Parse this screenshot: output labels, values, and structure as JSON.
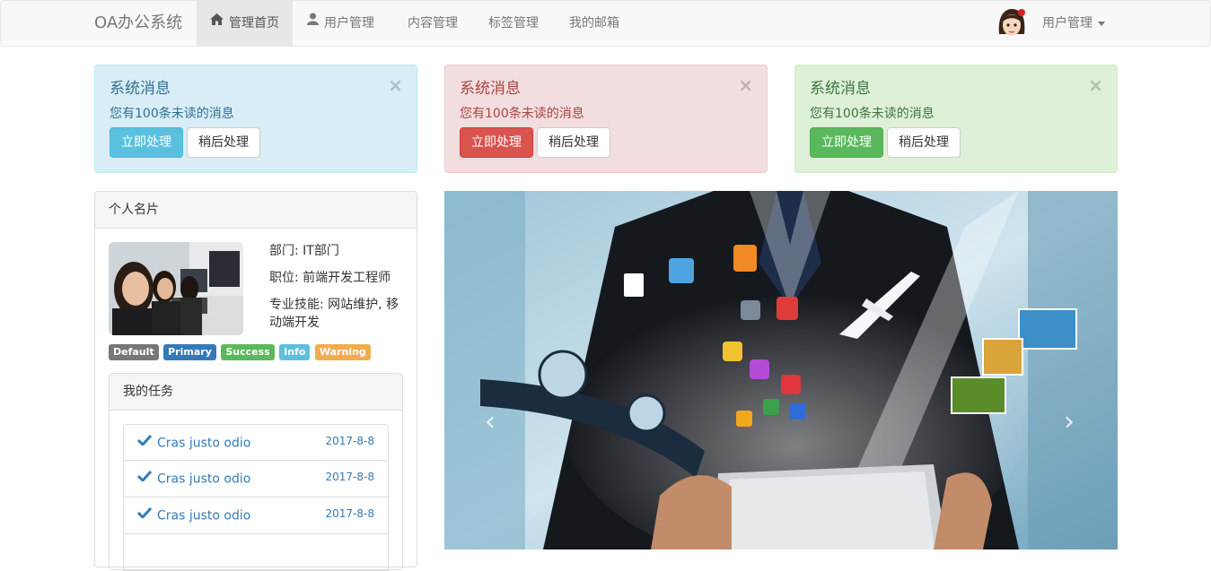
{
  "navbar": {
    "brand": "OA办公系统",
    "items": [
      {
        "label": "管理首页",
        "icon": "home-icon",
        "active": true
      },
      {
        "label": "用户管理",
        "icon": "user-icon",
        "active": false
      },
      {
        "label": "内容管理",
        "active": false
      },
      {
        "label": "标签管理",
        "active": false
      },
      {
        "label": "我的邮箱",
        "active": false
      }
    ],
    "user_menu": "用户管理"
  },
  "alerts": [
    {
      "title": "系统消息",
      "text": "您有100条未读的消息",
      "primary_btn": "立即处理",
      "secondary_btn": "稍后处理",
      "close": "×",
      "variant": "info"
    },
    {
      "title": "系统消息",
      "text": "您有100条未读的消息",
      "primary_btn": "立即处理",
      "secondary_btn": "稍后处理",
      "close": "×",
      "variant": "danger"
    },
    {
      "title": "系统消息",
      "text": "您有100条未读的消息",
      "primary_btn": "立即处理",
      "secondary_btn": "稍后处理",
      "close": "×",
      "variant": "success"
    }
  ],
  "profile": {
    "heading": "个人名片",
    "department": "部门: IT部门",
    "position": "职位: 前端开发工程师",
    "skills": "专业技能: 网站维护, 移动端开发",
    "labels": [
      "Default",
      "Primary",
      "Success",
      "Info",
      "Warning"
    ]
  },
  "tasks": {
    "heading": "我的任务",
    "items": [
      {
        "text": "Cras justo odio",
        "date": "2017-8-8"
      },
      {
        "text": "Cras justo odio",
        "date": "2017-8-8"
      },
      {
        "text": "Cras justo odio",
        "date": "2017-8-8"
      }
    ]
  },
  "carousel": {
    "prev": "‹",
    "next": "›"
  },
  "colors": {
    "info": "#5bc0de",
    "danger": "#d9534f",
    "success": "#5cb85c",
    "primary": "#337ab7"
  }
}
